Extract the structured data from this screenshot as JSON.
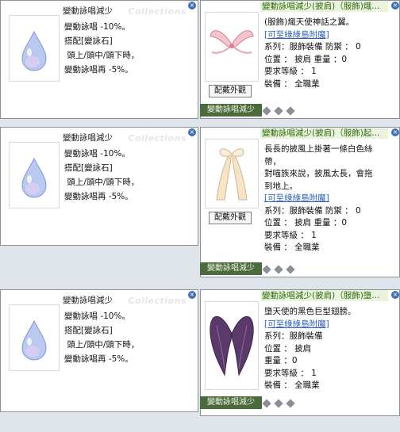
{
  "watermark": "Collections",
  "close_glyph": "×",
  "left_card": {
    "title": "變動詠唱減少",
    "lines": [
      "變動詠唱 -10%。",
      "搭配[變詠石]",
      " 頭上/頭中/頭下時，",
      "變動詠唱再 -5%。"
    ]
  },
  "left_card_b": {
    "lines": [
      "變動詠唱 -10%。",
      "搭配[變詠石]",
      " 頭上/頭中/頭下時，",
      "變動詠唱再 -5%。"
    ]
  },
  "rows": [
    {
      "right": {
        "title": "變動詠唱減少(披肩)（服飾)熾...",
        "button": "配戴外觀",
        "text_lines": [
          "(服飾)熾天使神話之翼。"
        ],
        "link": "[可至綠綠島附魔]",
        "props": [
          "系列：服飾裝備  防禦 ： 0",
          "位置 ： 披肩   重量 ：0",
          "要求等級 ： 1",
          "裝備 ： 全職業"
        ],
        "slot": "變動詠唱減少",
        "wing_color": "#e9a3b3"
      }
    },
    {
      "right": {
        "title": "變動詠唱減少(披肩)（服飾)起...",
        "button": "配戴外觀",
        "text_lines": [
          "長長的披風上掛著一條白色絲",
          "帶，",
          "對喵族來說，披風太長，會拖",
          "到地上。"
        ],
        "link": "[可至綠綠島附魔]",
        "props": [
          "系列：服飾裝備  防禦 ： 0",
          "位置 ： 披肩   重量 ：0",
          "要求等級 ： 1",
          "裝備 ： 全職業"
        ],
        "slot": "變動詠唱減少",
        "wing_color": "#f3d9b8"
      }
    },
    {
      "right": {
        "title": "變動詠唱減少(披肩)（服飾)墮...",
        "button": "",
        "text_lines": [
          "墮天使的黑色巨型翅膀。"
        ],
        "link": "[可至綠綠島附魔]",
        "props": [
          "系列：服飾裝備",
          "位置 ： 披肩",
          "重量 ：0",
          "要求等級 ： 1",
          "裝備 ： 全職業"
        ],
        "slot": "變動詠唱減少",
        "wing_color": "#5b3a6b"
      }
    }
  ]
}
